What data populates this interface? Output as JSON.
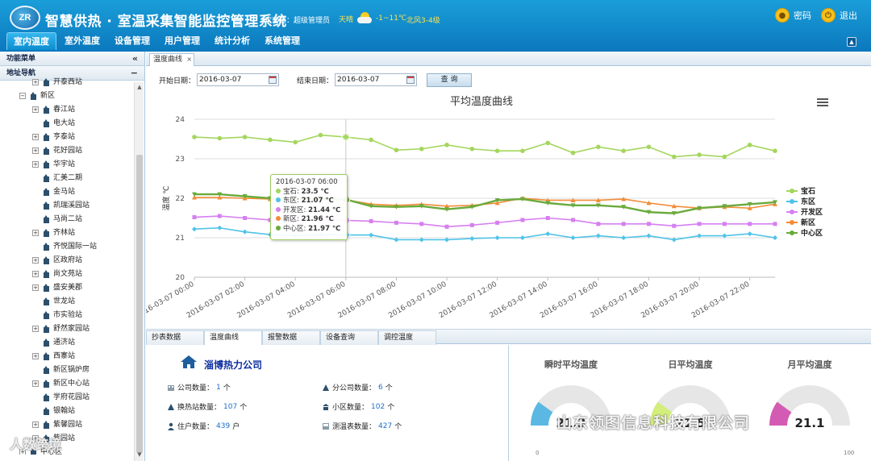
{
  "header": {
    "logo_text": "ZR",
    "title": "智慧供热 · 室温采集智能监控管理系统",
    "welcome": "欢迎您：超级管理员",
    "weather_text": "天晴",
    "temp_range": "-1~11℃",
    "wind": "北风3-4级",
    "password_label": "密码",
    "logout_label": "退出"
  },
  "nav": {
    "tabs": [
      "室内温度",
      "室外温度",
      "设备管理",
      "用户管理",
      "统计分析",
      "系统管理"
    ],
    "active": 0
  },
  "sidebar": {
    "function_menu": "功能菜单",
    "address_nav": "地址导航",
    "tree": [
      {
        "label": "开泰西站",
        "level": 2,
        "toggle": "+"
      },
      {
        "label": "新区",
        "level": 1,
        "toggle": "−"
      },
      {
        "label": "春江站",
        "level": 2,
        "toggle": "+"
      },
      {
        "label": "电大站",
        "level": 2,
        "toggle": ""
      },
      {
        "label": "亨泰站",
        "level": 2,
        "toggle": "+"
      },
      {
        "label": "花好园站",
        "level": 2,
        "toggle": "+"
      },
      {
        "label": "华宇站",
        "level": 2,
        "toggle": "+"
      },
      {
        "label": "汇美二期",
        "level": 2,
        "toggle": ""
      },
      {
        "label": "金马站",
        "level": 2,
        "toggle": ""
      },
      {
        "label": "凯瑞溪园站",
        "level": 2,
        "toggle": ""
      },
      {
        "label": "马尚二站",
        "level": 2,
        "toggle": ""
      },
      {
        "label": "齐林站",
        "level": 2,
        "toggle": "+"
      },
      {
        "label": "齐悦国际一站",
        "level": 2,
        "toggle": ""
      },
      {
        "label": "区政府站",
        "level": 2,
        "toggle": "+"
      },
      {
        "label": "尚文苑站",
        "level": 2,
        "toggle": "+"
      },
      {
        "label": "盛安美郡",
        "level": 2,
        "toggle": "+"
      },
      {
        "label": "世龙站",
        "level": 2,
        "toggle": ""
      },
      {
        "label": "市实验站",
        "level": 2,
        "toggle": ""
      },
      {
        "label": "舒然家园站",
        "level": 2,
        "toggle": "+"
      },
      {
        "label": "通济站",
        "level": 2,
        "toggle": ""
      },
      {
        "label": "西寨站",
        "level": 2,
        "toggle": "+"
      },
      {
        "label": "新区锅炉房",
        "level": 2,
        "toggle": ""
      },
      {
        "label": "新区中心站",
        "level": 2,
        "toggle": "+"
      },
      {
        "label": "学府花园站",
        "level": 2,
        "toggle": ""
      },
      {
        "label": "银翰站",
        "level": 2,
        "toggle": ""
      },
      {
        "label": "紫馨园站",
        "level": 2,
        "toggle": "+"
      },
      {
        "label": "紫园站",
        "level": 2,
        "toggle": "+"
      },
      {
        "label": "中心区",
        "level": 1,
        "toggle": "+"
      }
    ]
  },
  "page_tab": {
    "label": "温度曲线",
    "close": "×"
  },
  "filter": {
    "start_label": "开始日期：",
    "start_value": "2016-03-07",
    "end_label": "结束日期：",
    "end_value": "2016-03-07",
    "query_label": "查 询"
  },
  "chart_data": {
    "type": "line",
    "title": "平均温度曲线",
    "ylabel": "温度 ℃",
    "xlabel": "",
    "ylim": [
      20,
      24
    ],
    "yticks": [
      20,
      21,
      22,
      23,
      24
    ],
    "grid": true,
    "legend_position": "right",
    "xtick_labels": [
      "2016-03-07 00:00",
      "2016-03-07 02:00",
      "2016-03-07 04:00",
      "2016-03-07 06:00",
      "2016-03-07 08:00",
      "2016-03-07 10:00",
      "2016-03-07 12:00",
      "2016-03-07 14:00",
      "2016-03-07 16:00",
      "2016-03-07 18:00",
      "2016-03-07 20:00",
      "2016-03-07 22:00"
    ],
    "x_hours": [
      0,
      1,
      2,
      3,
      4,
      5,
      6,
      7,
      8,
      9,
      10,
      11,
      12,
      13,
      14,
      15,
      16,
      17,
      18,
      19,
      20,
      21,
      22,
      23
    ],
    "series": [
      {
        "name": "宝石",
        "color": "#a4d65e",
        "marker": "circle",
        "values": [
          23.55,
          23.52,
          23.55,
          23.48,
          23.42,
          23.6,
          23.55,
          23.48,
          23.22,
          23.25,
          23.35,
          23.25,
          23.2,
          23.2,
          23.4,
          23.15,
          23.3,
          23.2,
          23.3,
          23.05,
          23.1,
          23.05,
          23.35,
          23.2
        ]
      },
      {
        "name": "东区",
        "color": "#4fc3e8",
        "marker": "diamond",
        "values": [
          21.22,
          21.25,
          21.15,
          21.08,
          21.05,
          21.08,
          21.07,
          21.07,
          20.95,
          20.95,
          20.95,
          20.98,
          21.0,
          21.0,
          21.1,
          21.0,
          21.05,
          21.0,
          21.05,
          20.95,
          21.05,
          21.05,
          21.1,
          21.0
        ]
      },
      {
        "name": "开发区",
        "color": "#d67ff0",
        "marker": "square",
        "values": [
          21.52,
          21.55,
          21.5,
          21.45,
          21.45,
          21.45,
          21.44,
          21.42,
          21.38,
          21.35,
          21.28,
          21.32,
          21.38,
          21.45,
          21.5,
          21.45,
          21.35,
          21.35,
          21.35,
          21.3,
          21.35,
          21.35,
          21.35,
          21.35
        ]
      },
      {
        "name": "新区",
        "color": "#f28c37",
        "marker": "triangle",
        "values": [
          22.02,
          22.02,
          22.0,
          21.98,
          21.98,
          21.98,
          21.96,
          21.85,
          21.82,
          21.85,
          21.8,
          21.82,
          21.88,
          22.0,
          21.95,
          21.95,
          21.95,
          21.98,
          21.88,
          21.8,
          21.75,
          21.78,
          21.75,
          21.85
        ]
      },
      {
        "name": "中心区",
        "color": "#6aaa3c",
        "marker": "triangle-down",
        "values": [
          22.1,
          22.1,
          22.05,
          22.0,
          21.98,
          21.98,
          21.97,
          21.8,
          21.78,
          21.8,
          21.72,
          21.78,
          21.95,
          21.98,
          21.88,
          21.82,
          21.82,
          21.78,
          21.65,
          21.62,
          21.75,
          21.8,
          21.85,
          21.9
        ]
      }
    ],
    "tooltip": {
      "time": "2016-03-07 06:00",
      "rows": [
        {
          "name": "宝石",
          "value": "23.5 ℃"
        },
        {
          "name": "东区",
          "value": "21.07 ℃"
        },
        {
          "name": "开发区",
          "value": "21.44 ℃"
        },
        {
          "name": "新区",
          "value": "21.96 ℃"
        },
        {
          "name": "中心区",
          "value": "21.97 ℃"
        }
      ]
    }
  },
  "bottom_tabs": [
    "抄表数据",
    "温度曲线",
    "报警数据",
    "设备查询",
    "调控温度"
  ],
  "company": {
    "name": "淄博热力公司",
    "stats": {
      "company_count_label": "公司数量：",
      "company_count": "1",
      "company_count_unit": "个",
      "branch_count_label": "分公司数量：",
      "branch_count": "6",
      "branch_count_unit": "个",
      "station_count_label": "换热站数量：",
      "station_count": "107",
      "station_count_unit": "个",
      "community_count_label": "小区数量：",
      "community_count": "102",
      "community_count_unit": "个",
      "household_count_label": "住户数量：",
      "household_count": "439",
      "household_count_unit": "户",
      "meter_count_label": "测温表数量：",
      "meter_count": "427",
      "meter_count_unit": "个"
    }
  },
  "gauges": [
    {
      "title": "瞬时平均温度",
      "value": "21.3",
      "fraction": 0.2,
      "color": "#5bb8e3",
      "min": "0",
      "max": ""
    },
    {
      "title": "日平均温度",
      "value": "21.5",
      "fraction": 0.2,
      "color": "#d3ee7a",
      "min": "",
      "max": ""
    },
    {
      "title": "月平均温度",
      "value": "21.1",
      "fraction": 0.2,
      "color": "#d45bb3",
      "min": "",
      "max": "100"
    }
  ],
  "watermark": {
    "left": "人数跨境",
    "right": "山东领图信息科技有限公司"
  }
}
